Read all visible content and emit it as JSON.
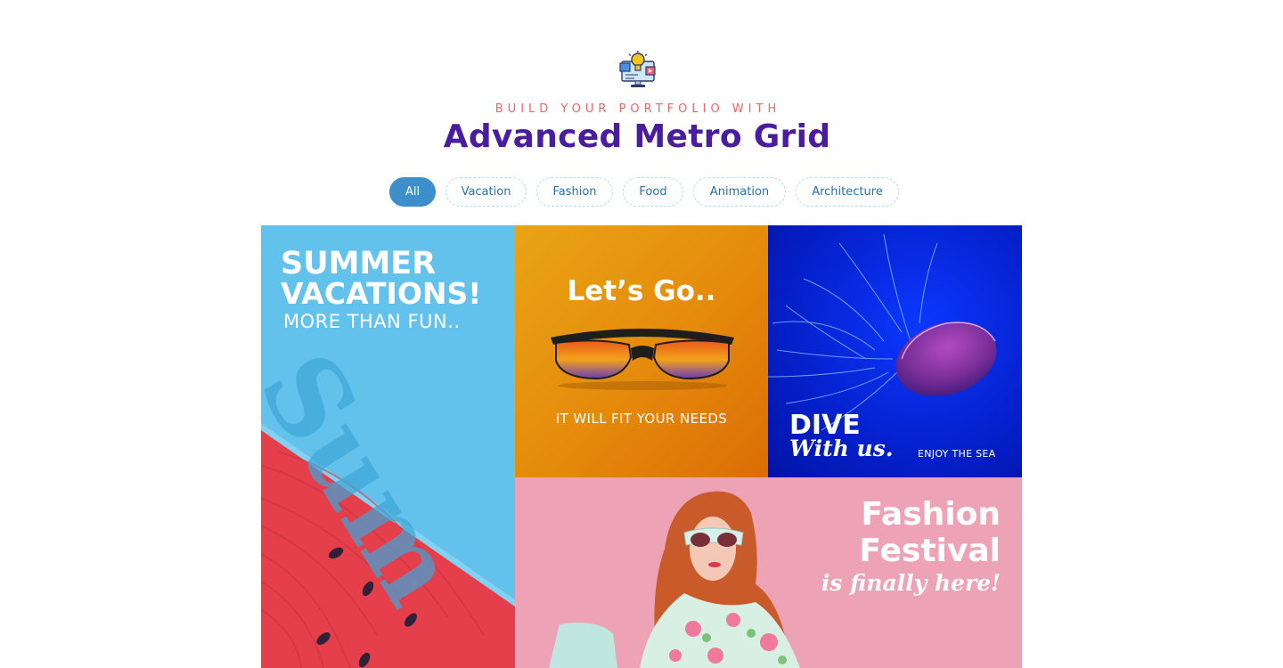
{
  "header": {
    "logo_icon": "idea-monitor-icon",
    "kicker": "BUILD YOUR PORTFOLIO WITH",
    "title": "Advanced Metro Grid"
  },
  "filters": [
    {
      "label": "All",
      "active": true
    },
    {
      "label": "Vacation",
      "active": false
    },
    {
      "label": "Fashion",
      "active": false
    },
    {
      "label": "Food",
      "active": false
    },
    {
      "label": "Animation",
      "active": false
    },
    {
      "label": "Architecture",
      "active": false
    }
  ],
  "tiles": {
    "summer": {
      "line1": "SUMMER",
      "line2": "VACATIONS!",
      "line3": "MORE THAN FUN..",
      "watermark": "Sum"
    },
    "sunglasses": {
      "title": "Let’s Go..",
      "tagline": "IT WILL FIT YOUR NEEDS"
    },
    "dive": {
      "title": "DIVE",
      "script": "With us.",
      "tagline": "ENJOY THE SEA"
    },
    "fashion": {
      "line1": "Fashion",
      "line2": "Festival",
      "script": "is finally here!"
    }
  },
  "colors": {
    "kicker": "#ef6464",
    "title": "#4a1d9e",
    "pill_active": "#3d8fcb",
    "pill_text": "#2a6fa8"
  }
}
